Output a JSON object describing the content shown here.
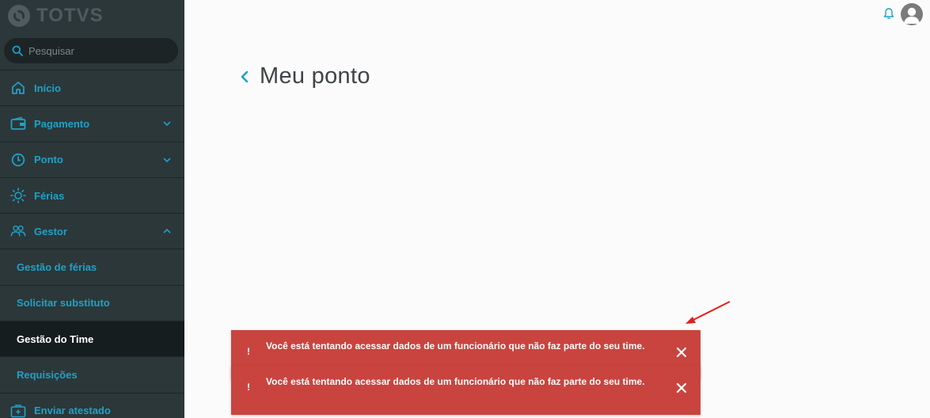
{
  "brand": {
    "logo_text": "TOTVS"
  },
  "search": {
    "placeholder": "Pesquisar"
  },
  "menu": {
    "items": [
      {
        "label": "Início",
        "icon": "home-icon"
      },
      {
        "label": "Pagamento",
        "icon": "wallet-icon",
        "chevron": "down"
      },
      {
        "label": "Ponto",
        "icon": "clock-icon",
        "chevron": "down"
      },
      {
        "label": "Férias",
        "icon": "sun-icon"
      },
      {
        "label": "Gestor",
        "icon": "team-icon",
        "chevron": "up"
      },
      {
        "label": "Gestão de férias"
      },
      {
        "label": "Solicitar substituto"
      },
      {
        "label": "Gestão do Time",
        "active": true
      },
      {
        "label": "Requisições"
      },
      {
        "label": "Enviar atestado",
        "icon": "medical-kit-icon"
      }
    ]
  },
  "header": {
    "icons": [
      "bell-icon",
      "avatar"
    ]
  },
  "page": {
    "title": "Meu ponto"
  },
  "notifications": [
    {
      "icon": "!",
      "message": "Você está tentando acessar dados de um funcionário que não faz parte do seu time."
    },
    {
      "icon": "!",
      "message": "Você está tentando acessar dados de um funcionário que não faz parte do seu time."
    }
  ],
  "colors": {
    "sidebar_bg": "#2c3739",
    "accent": "#1ea2c8",
    "toast_error": "#c9443e",
    "annotation_arrow": "#e0201c"
  }
}
